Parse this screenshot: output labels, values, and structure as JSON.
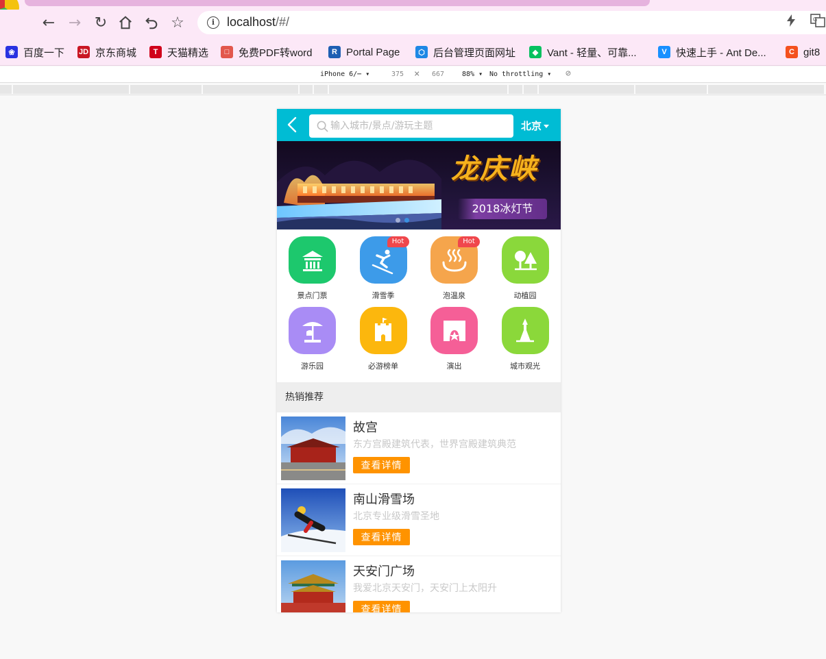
{
  "browser": {
    "url_host": "localhost",
    "url_path": "/#/",
    "bookmarks": [
      {
        "label": "百度一下",
        "icon": "baidu-icon",
        "color": "#2932e1"
      },
      {
        "label": "京东商城",
        "icon": "jd-icon",
        "color": "#c91623"
      },
      {
        "label": "天猫精选",
        "icon": "tmall-icon",
        "color": "#d0021b"
      },
      {
        "label": "免费PDF转word",
        "icon": "pdf-icon",
        "color": "#e2574c"
      },
      {
        "label": "Portal Page",
        "icon": "portal-icon",
        "color": "#1e5fb3"
      },
      {
        "label": "后台管理页面网址",
        "icon": "admin-icon",
        "color": "#1e88e5"
      },
      {
        "label": "Vant - 轻量、可靠...",
        "icon": "vant-icon",
        "color": "#07c160"
      },
      {
        "label": "快速上手 - Ant De...",
        "icon": "antd-icon",
        "color": "#1890ff"
      },
      {
        "label": "git8",
        "icon": "gitee-icon",
        "color": "#f4511e"
      }
    ],
    "devtools": {
      "device": "iPhone 6/⋯",
      "width": "375",
      "height": "667",
      "zoom": "88%",
      "throttle": "No throttling"
    }
  },
  "app": {
    "header": {
      "search_placeholder": "输入城市/景点/游玩主题",
      "city": "北京"
    },
    "banner": {
      "title": "龙庆峡",
      "subtitle": "2018冰灯节",
      "slide_count": 2,
      "active_slide": 1
    },
    "categories": [
      {
        "label": "景点门票",
        "color": "#1dc86d",
        "icon": "pavilion-icon",
        "hot": ""
      },
      {
        "label": "滑雪季",
        "color": "#3d9be9",
        "icon": "skier-icon",
        "hot": "Hot"
      },
      {
        "label": "泡温泉",
        "color": "#f5a54c",
        "icon": "hotspring-icon",
        "hot": "Hot"
      },
      {
        "label": "动植园",
        "color": "#8ad83b",
        "icon": "tree-icon",
        "hot": ""
      },
      {
        "label": "游乐园",
        "color": "#a98cf5",
        "icon": "carousel-icon",
        "hot": ""
      },
      {
        "label": "必游榜单",
        "color": "#fcb70d",
        "icon": "castle-icon",
        "hot": ""
      },
      {
        "label": "演出",
        "color": "#f55f97",
        "icon": "stage-icon",
        "hot": ""
      },
      {
        "label": "城市观光",
        "color": "#8bd83a",
        "icon": "tower-icon",
        "hot": ""
      }
    ],
    "section_title": "热销推荐",
    "recommendations": [
      {
        "name": "故宫",
        "desc": "东方宫殿建筑代表，世界宫殿建筑典范",
        "button": "查看详情"
      },
      {
        "name": "南山滑雪场",
        "desc": "北京专业级滑雪圣地",
        "button": "查看详情"
      },
      {
        "name": "天安门广场",
        "desc": "我爱北京天安门，天安门上太阳升",
        "button": "查看详情"
      }
    ]
  }
}
